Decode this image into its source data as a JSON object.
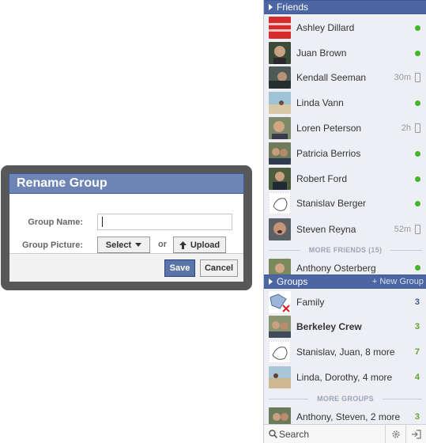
{
  "dialog": {
    "title": "Rename Group",
    "group_name_label": "Group Name:",
    "group_name_value": "",
    "group_picture_label": "Group Picture:",
    "select_label": "Select",
    "or_label": "or",
    "upload_label": "Upload",
    "save_label": "Save",
    "cancel_label": "Cancel"
  },
  "sidebar": {
    "friends_header": "Friends",
    "friends": [
      {
        "name": "Ashley Dillard",
        "status": "online"
      },
      {
        "name": "Juan Brown",
        "status": "online"
      },
      {
        "name": "Kendall Seeman",
        "status": "mobile",
        "idle": "30m"
      },
      {
        "name": "Linda Vann",
        "status": "online"
      },
      {
        "name": "Loren Peterson",
        "status": "mobile",
        "idle": "2h"
      },
      {
        "name": "Patricia Berrios",
        "status": "online"
      },
      {
        "name": "Robert Ford",
        "status": "online"
      },
      {
        "name": "Stanislav Berger",
        "status": "online"
      },
      {
        "name": "Steven Reyna",
        "status": "mobile",
        "idle": "52m"
      }
    ],
    "more_friends_label": "MORE FRIENDS (15)",
    "extra_friend": {
      "name": "Anthony Osterberg",
      "status": "online"
    },
    "groups_header": "Groups",
    "new_group_label": "+ New Group",
    "groups": [
      {
        "name": "Family",
        "count": "3",
        "bold": false
      },
      {
        "name": "Berkeley Crew",
        "count": "3",
        "bold": true
      },
      {
        "name": "Stanislav, Juan, 8 more",
        "count": "7",
        "bold": false
      },
      {
        "name": "Linda, Dorothy, 4 more",
        "count": "4",
        "bold": false
      }
    ],
    "more_groups_label": "MORE GROUPS",
    "extra_group": {
      "name": "Anthony, Steven, 2 more",
      "count": "3"
    },
    "search_placeholder": "Search"
  },
  "colors": {
    "header_blue": "#4c66a4",
    "dialog_header": "#6d84b4",
    "online_green": "#42b72a",
    "count_blue": "#3b5998",
    "count_green": "#5fa42f"
  }
}
